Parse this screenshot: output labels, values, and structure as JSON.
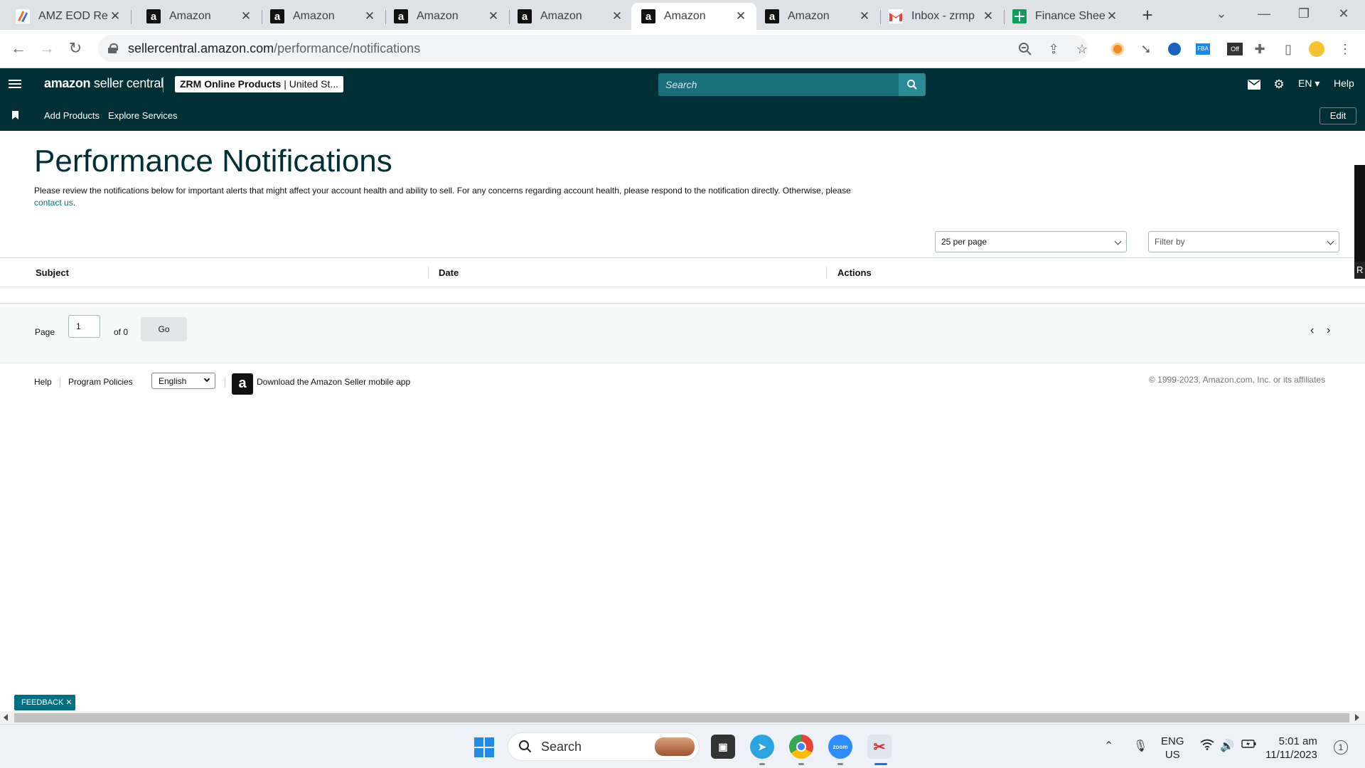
{
  "browser": {
    "tabs": [
      {
        "title": "AMZ EOD Rep",
        "icon": "amz-eod-icon",
        "active": false
      },
      {
        "title": "Amazon",
        "icon": "amazon-icon",
        "active": false
      },
      {
        "title": "Amazon",
        "icon": "amazon-icon",
        "active": false
      },
      {
        "title": "Amazon",
        "icon": "amazon-icon",
        "active": false
      },
      {
        "title": "Amazon",
        "icon": "amazon-icon",
        "active": false
      },
      {
        "title": "Amazon",
        "icon": "amazon-icon",
        "active": true
      },
      {
        "title": "Amazon",
        "icon": "amazon-icon",
        "active": false
      },
      {
        "title": "Inbox - zrmp",
        "icon": "gmail-icon",
        "active": false
      },
      {
        "title": "Finance Shee",
        "icon": "sheets-icon",
        "active": false
      }
    ],
    "url_host": "sellercentral.amazon.com",
    "url_path": "/performance/notifications"
  },
  "header": {
    "logo_bold": "amazon",
    "logo_rest": " seller central",
    "account_name": "ZRM Online Products",
    "account_market": "United St...",
    "search_placeholder": "Search",
    "language": "EN",
    "help": "Help"
  },
  "subnav": {
    "items": [
      "Add Products",
      "Explore Services"
    ],
    "edit": "Edit"
  },
  "page": {
    "title": "Performance Notifications",
    "description": "Please review the notifications below for important alerts that might affect your account health and ability to sell. For any concerns regarding account health, please respond to the notification directly. Otherwise, please",
    "contact_link": "contact us",
    "per_page": "25 per page",
    "filter_by": "Filter by",
    "columns": [
      "Subject",
      "Date",
      "Actions"
    ],
    "pager": {
      "page_label": "Page",
      "page_value": "1",
      "of_label": "of 0",
      "go": "Go"
    }
  },
  "footer": {
    "help": "Help",
    "program_policies": "Program Policies",
    "language": "English",
    "app_link": "Download the Amazon Seller mobile app",
    "copyright": "© 1999-2023, Amazon.com, Inc. or its affiliates"
  },
  "feedback": "FEEDBACK",
  "taskbar": {
    "search": "Search",
    "lang_line1": "ENG",
    "lang_line2": "US",
    "time": "5:01 am",
    "date": "11/11/2023",
    "notifications": "1"
  },
  "colors": {
    "header_bg": "#002f36",
    "link": "#007185",
    "search_bg": "#1b6f7a"
  }
}
